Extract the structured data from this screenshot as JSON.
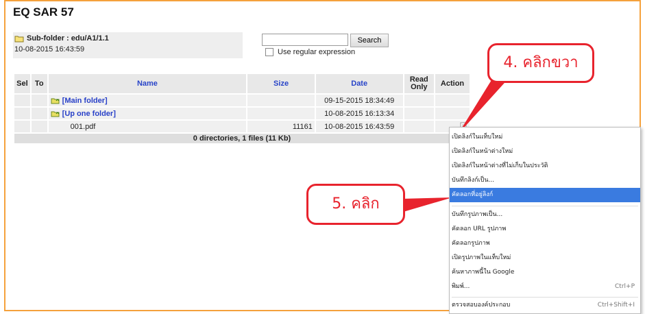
{
  "page_title": "EQ SAR 57",
  "folder": {
    "path_label": "Sub-folder : edu/A1/1.1",
    "date": "10-08-2015 16:43:59"
  },
  "search": {
    "value": "",
    "button_label": "Search",
    "regex_label": "Use regular expression"
  },
  "table": {
    "headers": {
      "sel": "Sel",
      "to": "To",
      "name": "Name",
      "size": "Size",
      "date": "Date",
      "read_only": "Read\nOnly",
      "action": "Action"
    },
    "rows": [
      {
        "name": "[Main folder]",
        "size": "",
        "date": "09-15-2015 18:34:49",
        "type": "folder-link"
      },
      {
        "name": "[Up one folder]",
        "size": "",
        "date": "10-08-2015 16:13:34",
        "type": "folder-link"
      },
      {
        "name": "001.pdf",
        "size": "11161",
        "date": "10-08-2015 16:43:59",
        "type": "file"
      }
    ],
    "summary": "0 directories, 1 files (11 Kb)"
  },
  "context_menu": {
    "items": [
      {
        "label": "เปิดลิงก์ในแท็บใหม่",
        "shortcut": ""
      },
      {
        "label": "เปิดลิงก์ในหน้าต่างใหม่",
        "shortcut": ""
      },
      {
        "label": "เปิดลิงก์ในหน้าต่างที่ไม่เก็บในประวัติ",
        "shortcut": ""
      },
      {
        "label": "บันทึกลิงก์เป็น...",
        "shortcut": ""
      },
      {
        "label": "คัดลอกที่อยู่ลิงก์",
        "shortcut": "",
        "highlighted": true
      },
      {
        "label": "บันทึกรูปภาพเป็น...",
        "shortcut": ""
      },
      {
        "label": "คัดลอก URL รูปภาพ",
        "shortcut": ""
      },
      {
        "label": "คัดลอกรูปภาพ",
        "shortcut": ""
      },
      {
        "label": "เปิดรูปภาพในแท็บใหม่",
        "shortcut": ""
      },
      {
        "label": "ค้นหาภาพนี้ใน Google",
        "shortcut": ""
      },
      {
        "label": "พิมพ์...",
        "shortcut": "Ctrl+P"
      },
      {
        "label": "ตรวจสอบองค์ประกอบ",
        "shortcut": "Ctrl+Shift+I"
      }
    ]
  },
  "callouts": {
    "right_click": "4. คลิกขวา",
    "click": "5. คลิก"
  },
  "colors": {
    "frame": "#f5a13c",
    "callout": "#e8232d",
    "highlight": "#3a7be0",
    "link": "#2840c8"
  }
}
